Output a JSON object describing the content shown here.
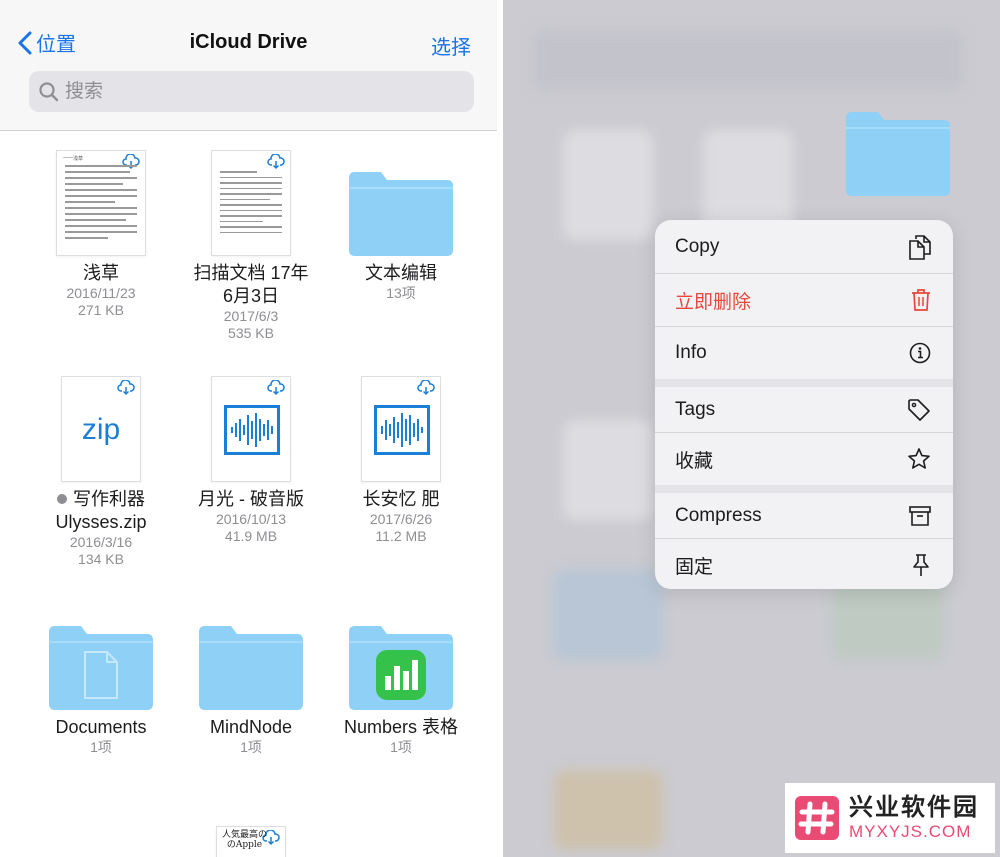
{
  "nav": {
    "back_label": "位置",
    "title": "iCloud Drive",
    "select_label": "选择"
  },
  "search": {
    "placeholder": "搜索"
  },
  "files": [
    {
      "name": "浅草",
      "date": "2016/11/23",
      "size": "271 KB",
      "type": "document"
    },
    {
      "name": "扫描文档 17年\n6月3日",
      "date": "2017/6/3",
      "size": "535 KB",
      "type": "document"
    },
    {
      "name": "文本编辑",
      "count": "13项",
      "type": "folder"
    },
    {
      "name": "写作利器\nUlysses.zip",
      "date": "2016/3/16",
      "size": "134 KB",
      "type": "zip",
      "zip_label": "zip"
    },
    {
      "name": "月光 - 破音版",
      "date": "2016/10/13",
      "size": "41.9 MB",
      "type": "audio"
    },
    {
      "name": "长安忆 肥",
      "date": "2017/6/26",
      "size": "11.2 MB",
      "type": "audio"
    },
    {
      "name": "Documents",
      "count": "1项",
      "type": "folder"
    },
    {
      "name": "MindNode",
      "count": "1项",
      "type": "folder"
    },
    {
      "name": "Numbers 表格",
      "count": "1项",
      "type": "folder"
    }
  ],
  "thumb_text": {
    "doc1_header": "一一浅草",
    "doc9_line1": "人気最高の",
    "doc9_line2": "のApple"
  },
  "context_menu": {
    "items": [
      {
        "label": "Copy",
        "icon": "copy-icon"
      },
      {
        "label": "立即删除",
        "icon": "trash-icon",
        "destructive": true
      },
      {
        "label": "Info",
        "icon": "info-icon"
      },
      {
        "label": "Tags",
        "icon": "tag-icon"
      },
      {
        "label": "收藏",
        "icon": "star-icon"
      },
      {
        "label": "Compress",
        "icon": "archive-icon"
      },
      {
        "label": "固定",
        "icon": "pin-icon"
      }
    ]
  },
  "watermark": {
    "cn": "兴业软件园",
    "en": "MYXYJS.COM"
  },
  "colors": {
    "accent": "#1a73e8",
    "folder": "#8fd0f7",
    "destructive": "#e5483c",
    "watermark_pink": "#e94b74"
  }
}
